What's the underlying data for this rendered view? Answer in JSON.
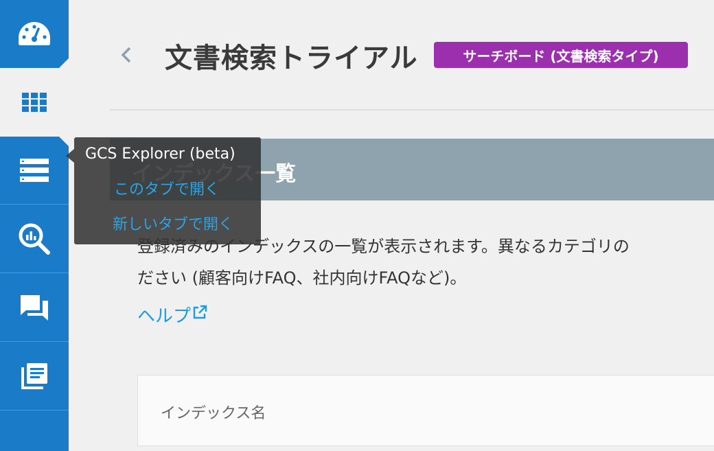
{
  "header": {
    "title": "文書検索トライアル",
    "badge": "サーチボード (文書検索タイプ)"
  },
  "section": {
    "title": "インデックス一覧",
    "description_line1": "登録済みのインデックスの一覧が表示されます。異なるカテゴリの",
    "description_line2": "ださい (顧客向けFAQ、社内向けFAQなど)。",
    "help_link": "ヘルプ"
  },
  "table": {
    "columns": [
      "インデックス名"
    ]
  },
  "tooltip": {
    "title": "GCS Explorer (beta)",
    "open_here": "このタブで開く",
    "open_new": "新しいタブで開く"
  },
  "sidebar": {
    "items": [
      {
        "icon": "dashboard-icon"
      },
      {
        "icon": "grid-icon"
      },
      {
        "icon": "list-icon"
      },
      {
        "icon": "search-analytics-icon"
      },
      {
        "icon": "chat-icon"
      },
      {
        "icon": "library-icon"
      }
    ]
  },
  "colors": {
    "sidebar": "#1a7cc9",
    "badge": "#9b2fae",
    "section_bar": "#8ea3ad",
    "link": "#1a9de0"
  }
}
